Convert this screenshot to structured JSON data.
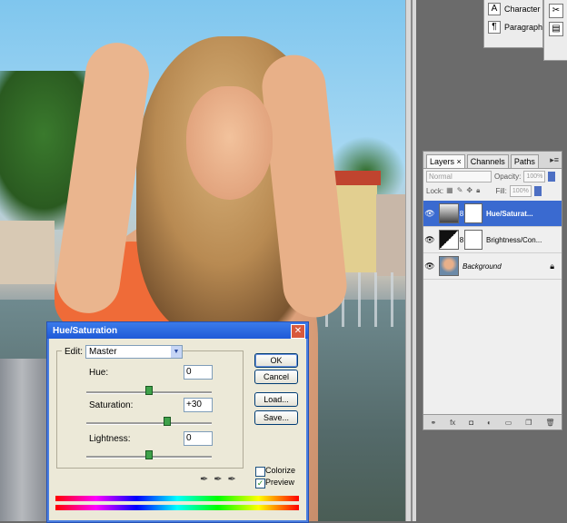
{
  "panels_top": {
    "items": [
      {
        "icon": "character-icon",
        "glyph": "A",
        "label": "Character"
      },
      {
        "icon": "paragraph-icon",
        "glyph": "¶",
        "label": "Paragraph"
      }
    ]
  },
  "layers_panel": {
    "tabs": [
      {
        "label": "Layers ×",
        "active": true
      },
      {
        "label": "Channels",
        "active": false
      },
      {
        "label": "Paths",
        "active": false
      }
    ],
    "blend_mode": "Normal",
    "opacity_label": "Opacity:",
    "opacity_value": "100%",
    "lock_label": "Lock:",
    "fill_label": "Fill:",
    "fill_value": "100%",
    "layers": [
      {
        "name": "Hue/Saturat...",
        "kind": "adjustment",
        "active": true
      },
      {
        "name": "Brightness/Con...",
        "kind": "adjustment",
        "active": false
      },
      {
        "name": "Background",
        "kind": "image",
        "active": false
      }
    ]
  },
  "dialog": {
    "title": "Hue/Saturation",
    "edit_label": "Edit:",
    "edit_value": "Master",
    "hue_label": "Hue:",
    "hue_value": "0",
    "saturation_label": "Saturation:",
    "saturation_value": "+30",
    "lightness_label": "Lightness:",
    "lightness_value": "0",
    "buttons": {
      "ok": "OK",
      "cancel": "Cancel",
      "load": "Load...",
      "save": "Save..."
    },
    "colorize_label": "Colorize",
    "colorize_checked": false,
    "preview_label": "Preview",
    "preview_checked": true
  }
}
